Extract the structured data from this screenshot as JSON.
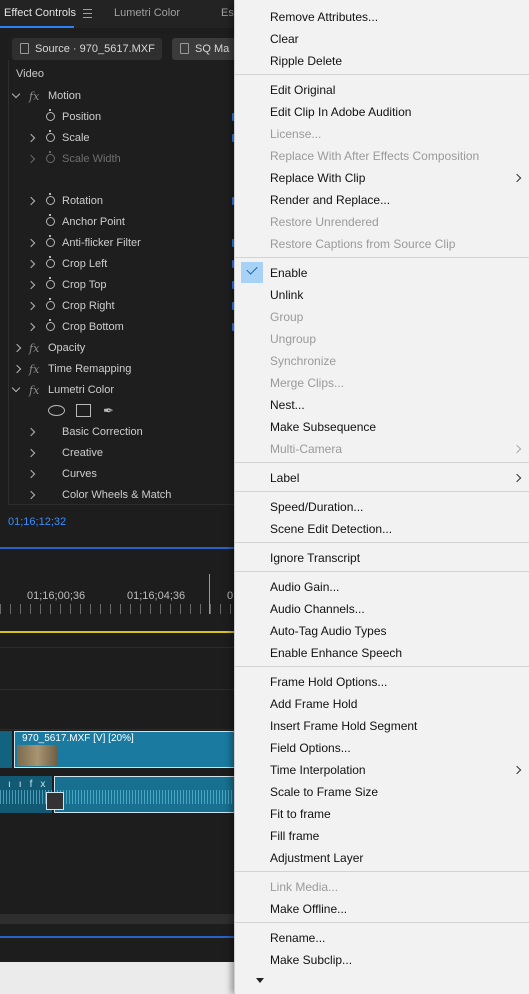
{
  "tabs": {
    "effect_controls": "Effect Controls",
    "lumetri": "Lumetri Color",
    "es": "Es"
  },
  "clip_tabs": {
    "source": "Source · 970_5617.MXF",
    "sequence": "SQ Ma"
  },
  "effect_controls": {
    "video_label": "Video",
    "fx_symbol": "fx",
    "rows": [
      {
        "label": "Motion"
      },
      {
        "label": "Position"
      },
      {
        "label": "Scale"
      },
      {
        "label": "Scale Width"
      },
      {
        "label": "Rotation"
      },
      {
        "label": "Anchor Point"
      },
      {
        "label": "Anti-flicker Filter"
      },
      {
        "label": "Crop Left"
      },
      {
        "label": "Crop Top"
      },
      {
        "label": "Crop Right"
      },
      {
        "label": "Crop Bottom"
      },
      {
        "label": "Opacity"
      },
      {
        "label": "Time Remapping"
      },
      {
        "label": "Lumetri Color"
      },
      {
        "label": "Basic Correction"
      },
      {
        "label": "Creative"
      },
      {
        "label": "Curves"
      },
      {
        "label": "Color Wheels & Match"
      }
    ],
    "timecode": "01;16;12;32"
  },
  "timeline": {
    "ruler_labels": [
      "01;16;00;36",
      "01;16;04;36",
      "0"
    ],
    "video_clip_label": "970_5617.MXF [V] [20%]",
    "audio_icons": "fx"
  },
  "context_menu": {
    "items": [
      {
        "label": "Remove Attributes...",
        "enabled": true
      },
      {
        "label": "Clear",
        "enabled": true
      },
      {
        "label": "Ripple Delete",
        "enabled": true
      },
      {
        "label": "Edit Original",
        "enabled": true
      },
      {
        "label": "Edit Clip In Adobe Audition",
        "enabled": true
      },
      {
        "label": "License...",
        "enabled": false
      },
      {
        "label": "Replace With After Effects Composition",
        "enabled": false
      },
      {
        "label": "Replace With Clip",
        "enabled": true,
        "submenu": true
      },
      {
        "label": "Render and Replace...",
        "enabled": true
      },
      {
        "label": "Restore Unrendered",
        "enabled": false
      },
      {
        "label": "Restore Captions from Source Clip",
        "enabled": false
      },
      {
        "label": "Enable",
        "enabled": true,
        "checked": true
      },
      {
        "label": "Unlink",
        "enabled": true
      },
      {
        "label": "Group",
        "enabled": false
      },
      {
        "label": "Ungroup",
        "enabled": false
      },
      {
        "label": "Synchronize",
        "enabled": false
      },
      {
        "label": "Merge Clips...",
        "enabled": false
      },
      {
        "label": "Nest...",
        "enabled": true
      },
      {
        "label": "Make Subsequence",
        "enabled": true
      },
      {
        "label": "Multi-Camera",
        "enabled": false,
        "submenu": true
      },
      {
        "label": "Label",
        "enabled": true,
        "submenu": true
      },
      {
        "label": "Speed/Duration...",
        "enabled": true
      },
      {
        "label": "Scene Edit Detection...",
        "enabled": true
      },
      {
        "label": "Ignore Transcript",
        "enabled": true
      },
      {
        "label": "Audio Gain...",
        "enabled": true
      },
      {
        "label": "Audio Channels...",
        "enabled": true
      },
      {
        "label": "Auto-Tag Audio Types",
        "enabled": true
      },
      {
        "label": "Enable Enhance Speech",
        "enabled": true
      },
      {
        "label": "Frame Hold Options...",
        "enabled": true
      },
      {
        "label": "Add Frame Hold",
        "enabled": true
      },
      {
        "label": "Insert Frame Hold Segment",
        "enabled": true
      },
      {
        "label": "Field Options...",
        "enabled": true
      },
      {
        "label": "Time Interpolation",
        "enabled": true,
        "submenu": true
      },
      {
        "label": "Scale to Frame Size",
        "enabled": true
      },
      {
        "label": "Fit to frame",
        "enabled": true
      },
      {
        "label": "Fill frame",
        "enabled": true
      },
      {
        "label": "Adjustment Layer",
        "enabled": true
      },
      {
        "label": "Link Media...",
        "enabled": false
      },
      {
        "label": "Make Offline...",
        "enabled": true
      },
      {
        "label": "Rename...",
        "enabled": true
      },
      {
        "label": "Make Subclip...",
        "enabled": true
      }
    ]
  },
  "colors": {
    "accent_blue": "#2c7ff6",
    "menu_bg": "#f2f2f2",
    "check_highlight": "#a8d2f5",
    "clip_video": "#1a7aa0"
  }
}
